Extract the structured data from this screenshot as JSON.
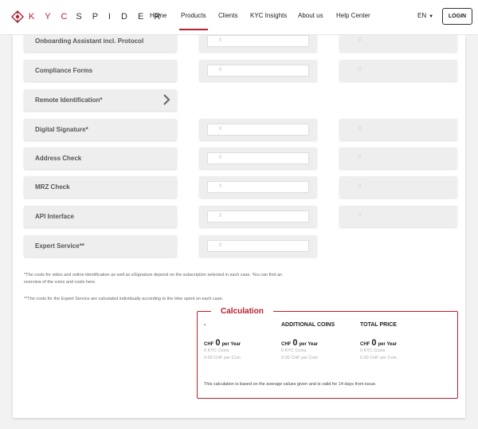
{
  "logo": {
    "kyc": "K Y C",
    "spider": "S P I D E R"
  },
  "nav": {
    "items": [
      {
        "label": "Home"
      },
      {
        "label": "Products"
      },
      {
        "label": "Clients"
      },
      {
        "label": "KYC Insights"
      },
      {
        "label": "About us"
      },
      {
        "label": "Help Center"
      }
    ],
    "active": "Products",
    "lang": "EN",
    "login": "LOGIN"
  },
  "products": [
    {
      "label": "Onboarding Assistant incl. Protocol",
      "qty": "0",
      "price": "0"
    },
    {
      "label": "Compliance Forms",
      "qty": "0",
      "price": "0"
    },
    {
      "label": "Remote Identification*"
    },
    {
      "label": "Digital Signature*",
      "qty": "0",
      "price": "0"
    },
    {
      "label": "Address Check",
      "qty": "0",
      "price": "0"
    },
    {
      "label": "MRZ Check",
      "qty": "0",
      "price": "0"
    },
    {
      "label": "API Interface",
      "qty": "0",
      "price": "0"
    },
    {
      "label": "Expert Service**",
      "qty": "0"
    }
  ],
  "notes": {
    "note1": "*The costs for video and online identification as well as eSignature depend on the subscription selected in each case. You can find an overview of the coins and costs here.",
    "note2": "**The costs for the Expert Service are calculated individually according to the time spent on each case."
  },
  "calculation": {
    "title": "Calculation",
    "columns": [
      {
        "header": "-",
        "currency": "CHF",
        "amount": "0",
        "period": "per Year",
        "coins": "0 KYC Coins",
        "per_coin": "0.00 CHF per Coin"
      },
      {
        "header": "ADDITIONAL COINS",
        "currency": "CHF",
        "amount": "0",
        "period": "per Year",
        "coins": "0 KYC Coins",
        "per_coin": "0.00 CHF per Coin"
      },
      {
        "header": "TOTAL PRICE",
        "currency": "CHF",
        "amount": "0",
        "period": "per Year",
        "coins": "0 KYC Coins",
        "per_coin": "0.00 CHF per Coin"
      }
    ],
    "footer": "This calculation is based on the average values given and is valid for 14 days from issue."
  },
  "colors": {
    "brand": "#b8202f"
  }
}
